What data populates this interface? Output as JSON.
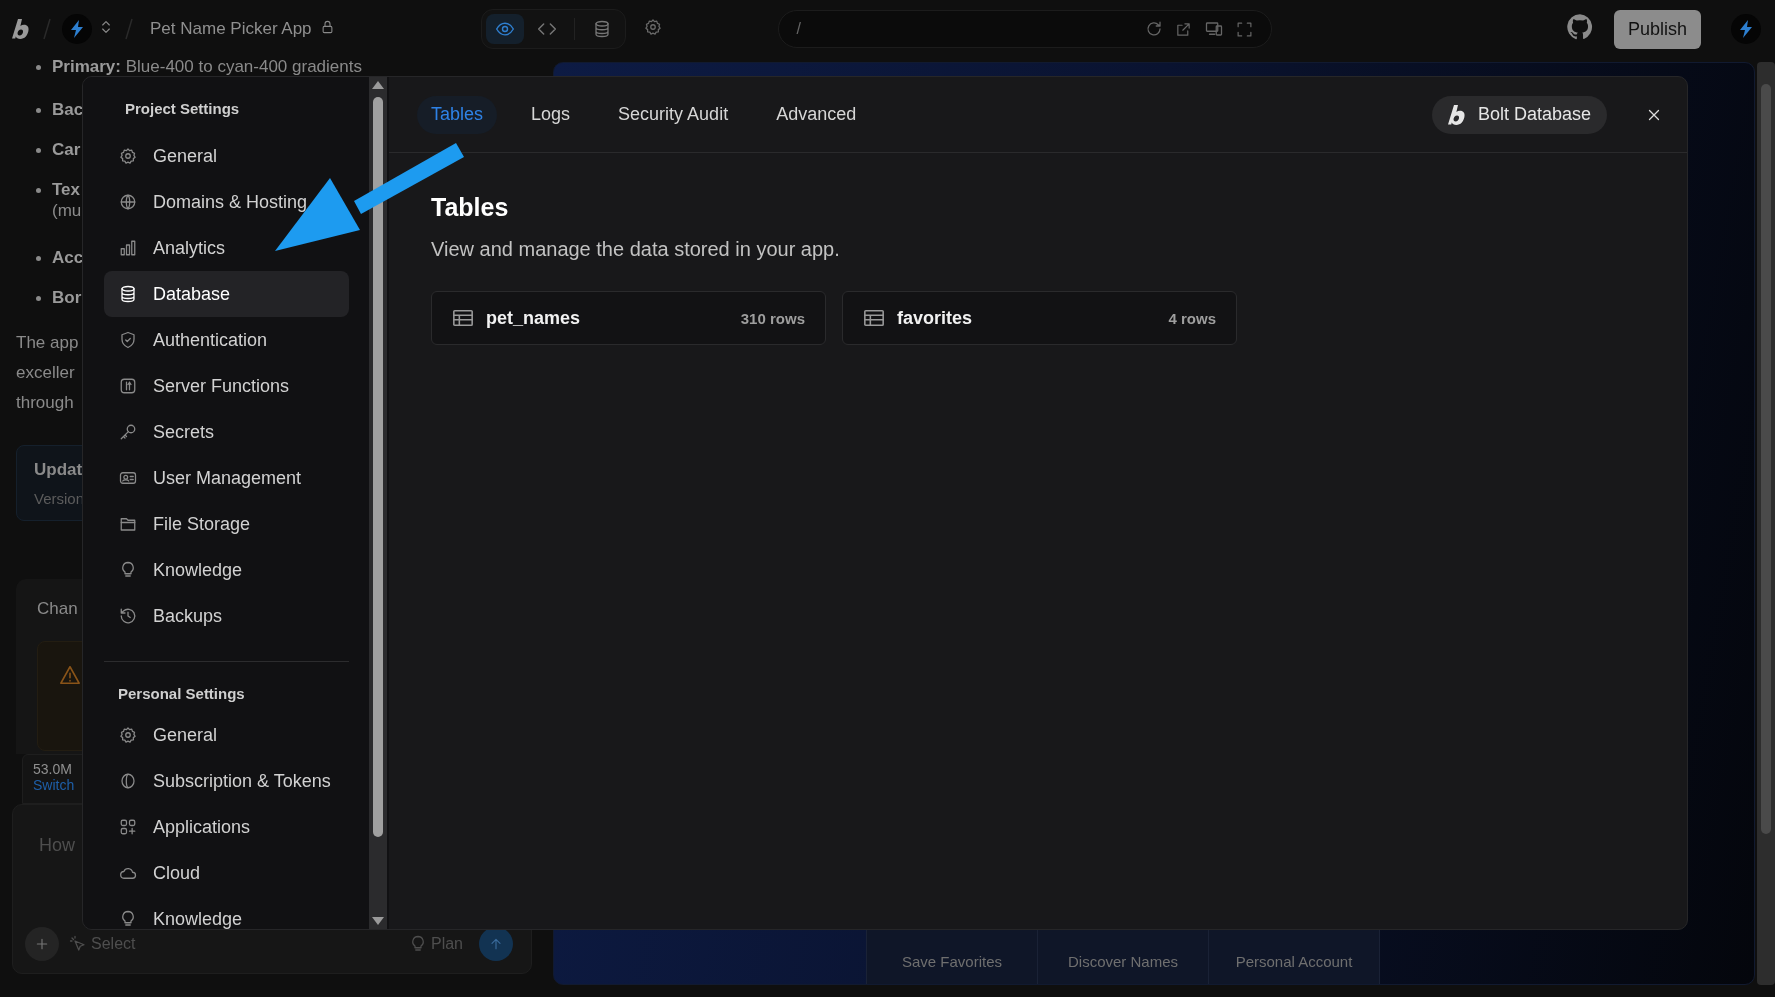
{
  "top_bar": {
    "project_title": "Pet Name Picker App",
    "view_toggles": [
      {
        "kind": "preview",
        "selected": true
      },
      {
        "kind": "code",
        "selected": false
      },
      {
        "kind": "database",
        "selected": false
      }
    ],
    "address": "/",
    "publish_button": "Publish"
  },
  "chat": {
    "bullets": [
      {
        "label": "Primary:",
        "text": "Blue-400 to cyan-400 gradients"
      },
      {
        "label": "Bac"
      },
      {
        "label": "Car"
      },
      {
        "label": "Tex",
        "continuation": "(mu"
      },
      {
        "label": "Acc"
      },
      {
        "label": "Bor"
      }
    ],
    "paragraph_lines": [
      "The app",
      "exceller",
      "through"
    ],
    "update_card": {
      "title": "Updat",
      "subtitle": "Version"
    },
    "changes_card": {
      "title": "Chan"
    },
    "usage": {
      "tokens": "53.0M",
      "link": "Switch"
    },
    "input": {
      "placeholder": "How"
    },
    "select_button": "Select",
    "plan_button": "Plan"
  },
  "preview": {
    "nav": [
      "Save Favorites",
      "Discover Names",
      "Personal Account"
    ]
  },
  "settings_modal": {
    "sections": [
      {
        "title": "Project Settings",
        "items": [
          {
            "label": "General",
            "selected": false
          },
          {
            "label": "Domains & Hosting",
            "selected": false
          },
          {
            "label": "Analytics",
            "selected": false
          },
          {
            "label": "Database",
            "selected": true
          },
          {
            "label": "Authentication",
            "selected": false
          },
          {
            "label": "Server Functions",
            "selected": false
          },
          {
            "label": "Secrets",
            "selected": false
          },
          {
            "label": "User Management",
            "selected": false
          },
          {
            "label": "File Storage",
            "selected": false
          },
          {
            "label": "Knowledge",
            "selected": false
          },
          {
            "label": "Backups",
            "selected": false
          }
        ]
      },
      {
        "title": "Personal Settings",
        "items": [
          {
            "label": "General",
            "selected": false
          },
          {
            "label": "Subscription & Tokens",
            "selected": false
          },
          {
            "label": "Applications",
            "selected": false
          },
          {
            "label": "Cloud",
            "selected": false
          },
          {
            "label": "Knowledge",
            "selected": false
          }
        ]
      }
    ],
    "tabs": [
      {
        "label": "Tables",
        "selected": true
      },
      {
        "label": "Logs",
        "selected": false
      },
      {
        "label": "Security Audit",
        "selected": false
      },
      {
        "label": "Advanced",
        "selected": false
      }
    ],
    "database_button": "Bolt Database",
    "heading": "Tables",
    "description": "View and manage the data stored in your app.",
    "tables": [
      {
        "name": "pet_names",
        "rows": "310 rows"
      },
      {
        "name": "favorites",
        "rows": "4 rows"
      }
    ]
  }
}
